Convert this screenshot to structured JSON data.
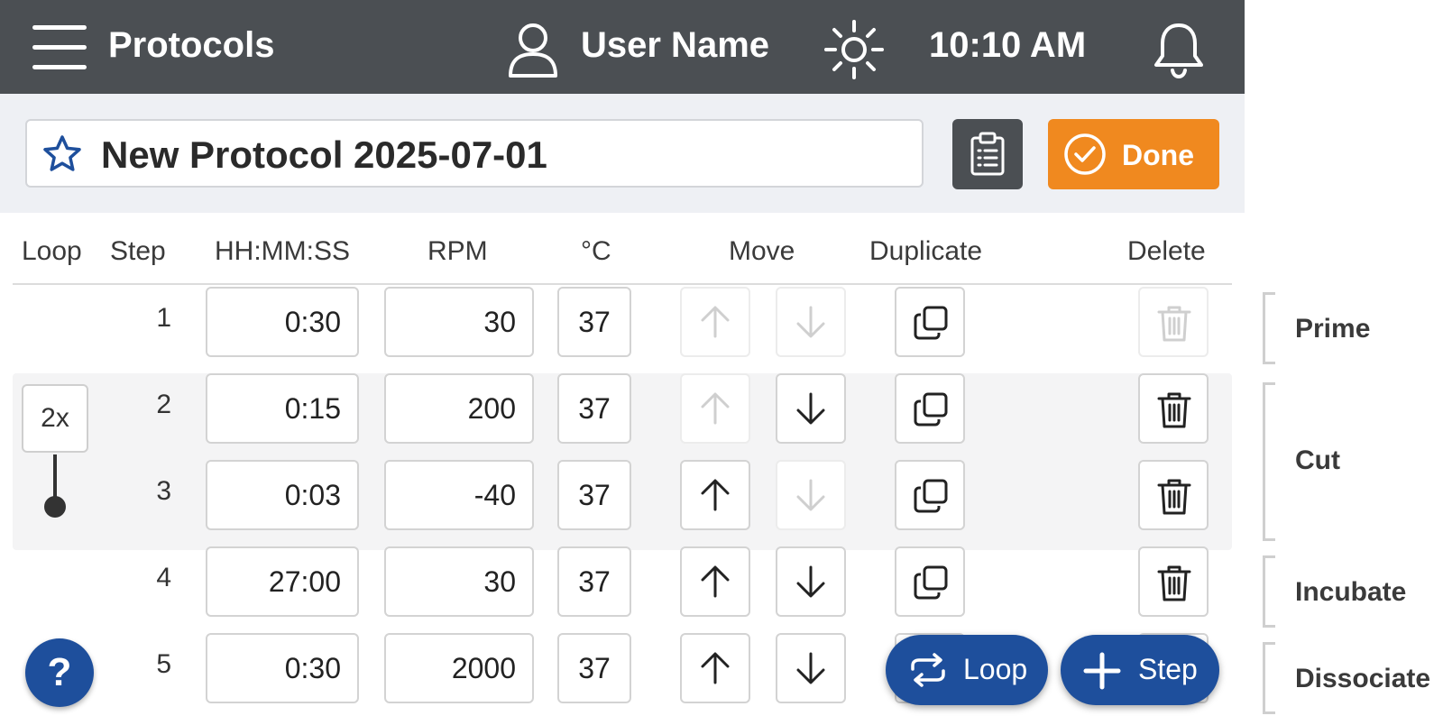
{
  "header": {
    "title": "Protocols",
    "user_name": "User Name",
    "time": "10:10 AM",
    "icons": [
      "menu-icon",
      "user-icon",
      "sun-icon",
      "bell-icon"
    ]
  },
  "protocol": {
    "name": "New Protocol 2025-07-01",
    "done_label": "Done"
  },
  "columns": {
    "loop": "Loop",
    "step": "Step",
    "time": "HH:MM:SS",
    "rpm": "RPM",
    "temp": "°C",
    "move": "Move",
    "duplicate": "Duplicate",
    "delete": "Delete"
  },
  "loop_group": {
    "count": "2x"
  },
  "steps": [
    {
      "num": "1",
      "time": "0:30",
      "rpm": "30",
      "temp": "37",
      "up_enabled": false,
      "down_enabled": false,
      "delete_enabled": false
    },
    {
      "num": "2",
      "time": "0:15",
      "rpm": "200",
      "temp": "37",
      "up_enabled": false,
      "down_enabled": true,
      "delete_enabled": true
    },
    {
      "num": "3",
      "time": "0:03",
      "rpm": "-40",
      "temp": "37",
      "up_enabled": true,
      "down_enabled": false,
      "delete_enabled": true
    },
    {
      "num": "4",
      "time": "27:00",
      "rpm": "30",
      "temp": "37",
      "up_enabled": true,
      "down_enabled": true,
      "delete_enabled": true
    },
    {
      "num": "5",
      "time": "0:30",
      "rpm": "2000",
      "temp": "37",
      "up_enabled": true,
      "down_enabled": true,
      "delete_enabled": true
    }
  ],
  "stages": [
    "Prime",
    "Cut",
    "Incubate",
    "Dissociate"
  ],
  "actions": {
    "help": "?",
    "loop": "Loop",
    "step": "Step"
  },
  "colors": {
    "header_bg": "#4b4f53",
    "accent_orange": "#f0891f",
    "accent_blue": "#1e4f9c"
  }
}
